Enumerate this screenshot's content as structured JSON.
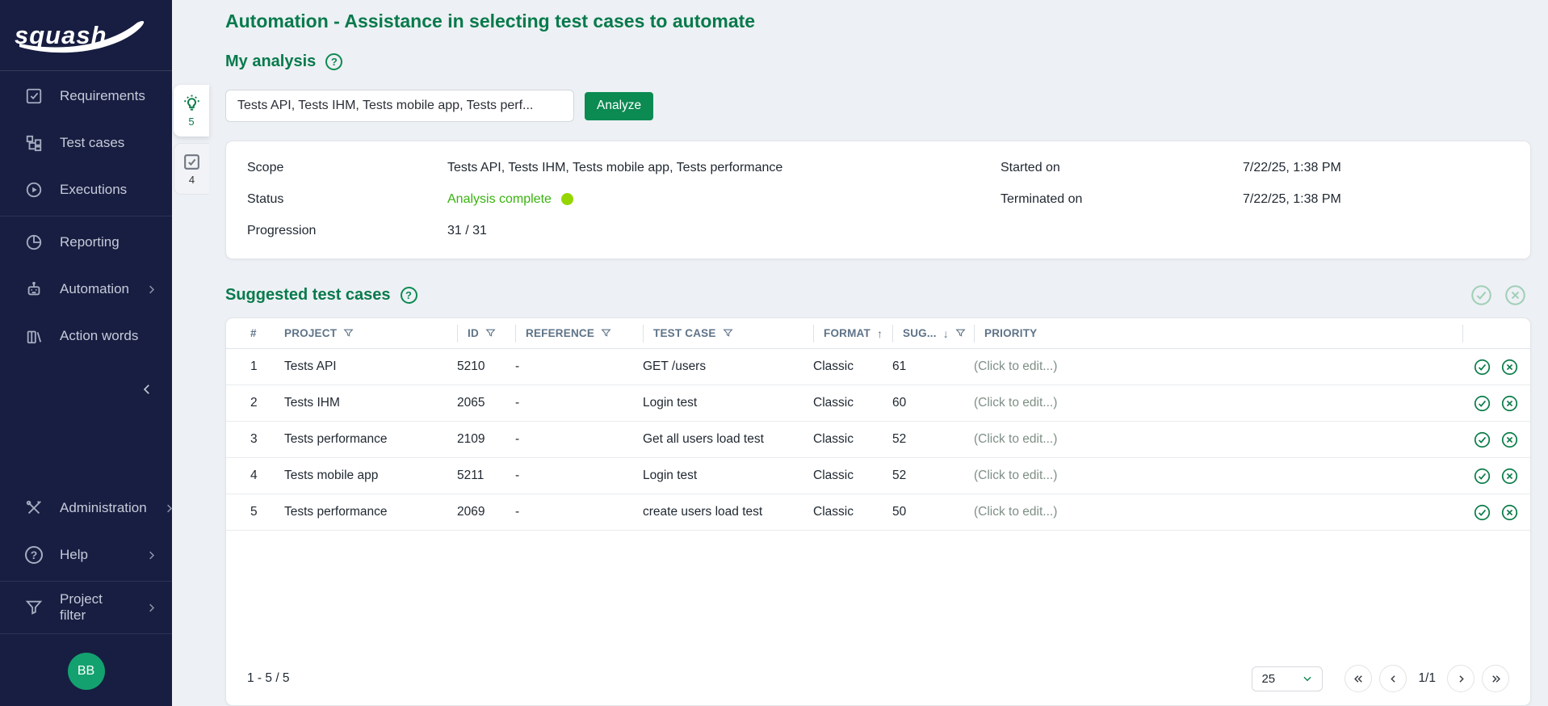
{
  "app": {
    "logo_text": "squash"
  },
  "sidebar": {
    "items": [
      {
        "label": "Requirements"
      },
      {
        "label": "Test cases"
      },
      {
        "label": "Executions"
      },
      {
        "label": "Reporting"
      },
      {
        "label": "Automation"
      },
      {
        "label": "Action words"
      }
    ],
    "bottom_items": [
      {
        "label": "Administration"
      },
      {
        "label": "Help"
      },
      {
        "label": "Project filter"
      }
    ],
    "avatar_initials": "BB"
  },
  "rail": {
    "tabs": [
      {
        "icon": "lightbulb-icon",
        "count": "5"
      },
      {
        "icon": "checkbox-icon",
        "count": "4"
      }
    ]
  },
  "header": {
    "title": "Automation - Assistance in selecting test cases to automate"
  },
  "analysis": {
    "section_title": "My analysis",
    "input_value": "Tests API, Tests IHM, Tests mobile app, Tests perf...",
    "analyze_label": "Analyze",
    "scope_label": "Scope",
    "scope_value": "Tests API, Tests IHM, Tests mobile app, Tests performance",
    "status_label": "Status",
    "status_value": "Analysis complete",
    "progression_label": "Progression",
    "progression_value": "31 / 31",
    "started_label": "Started on",
    "started_value": "7/22/25, 1:38 PM",
    "terminated_label": "Terminated on",
    "terminated_value": "7/22/25, 1:38 PM"
  },
  "suggestions": {
    "section_title": "Suggested test cases",
    "columns": [
      {
        "label": "#"
      },
      {
        "label": "PROJECT",
        "filter": true
      },
      {
        "label": "ID",
        "filter": true
      },
      {
        "label": "REFERENCE",
        "filter": true
      },
      {
        "label": "TEST CASE",
        "filter": true
      },
      {
        "label": "FORMAT",
        "sort": "asc"
      },
      {
        "label": "SUG...",
        "sort": "desc",
        "filter": true
      },
      {
        "label": "PRIORITY"
      }
    ],
    "rows": [
      {
        "num": "1",
        "project": "Tests API",
        "id": "5210",
        "reference": "-",
        "test_case": "GET /users",
        "format": "Classic",
        "sug": "61",
        "priority": "(Click to edit...)"
      },
      {
        "num": "2",
        "project": "Tests IHM",
        "id": "2065",
        "reference": "-",
        "test_case": "Login test",
        "format": "Classic",
        "sug": "60",
        "priority": "(Click to edit...)"
      },
      {
        "num": "3",
        "project": "Tests performance",
        "id": "2109",
        "reference": "-",
        "test_case": "Get all users load test",
        "format": "Classic",
        "sug": "52",
        "priority": "(Click to edit...)"
      },
      {
        "num": "4",
        "project": "Tests mobile app",
        "id": "5211",
        "reference": "-",
        "test_case": "Login test",
        "format": "Classic",
        "sug": "52",
        "priority": "(Click to edit...)"
      },
      {
        "num": "5",
        "project": "Tests performance",
        "id": "2069",
        "reference": "-",
        "test_case": "create users load test",
        "format": "Classic",
        "sug": "50",
        "priority": "(Click to edit...)"
      }
    ],
    "pagination": {
      "range": "1 - 5 / 5",
      "page_size": "25",
      "page_indicator": "1/1"
    }
  },
  "colors": {
    "sidebar_bg": "#171e41",
    "accent_green": "#0b8a52",
    "title_green": "#087a4c",
    "status_green": "#38b40d",
    "status_dot": "#96d600",
    "avatar_green": "#13a26f"
  }
}
